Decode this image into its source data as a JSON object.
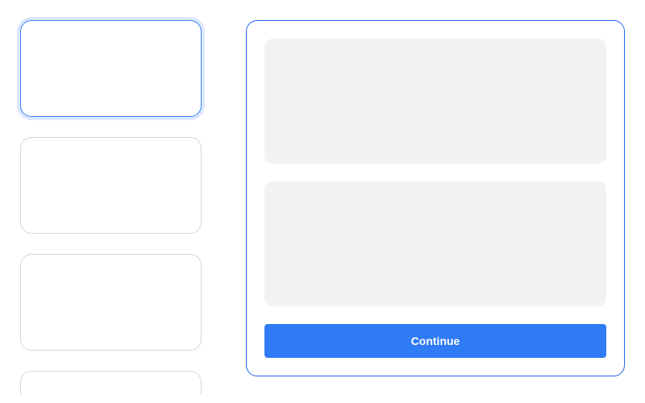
{
  "sidebar": {
    "items": [
      {
        "active": true
      },
      {
        "active": false
      },
      {
        "active": false
      },
      {
        "active": false
      }
    ]
  },
  "main": {
    "continue_label": "Continue"
  },
  "colors": {
    "accent": "#2f7bf5",
    "border_active": "#2563eb",
    "border_inactive": "#d1d5db",
    "block_bg": "#f1f2f4"
  }
}
